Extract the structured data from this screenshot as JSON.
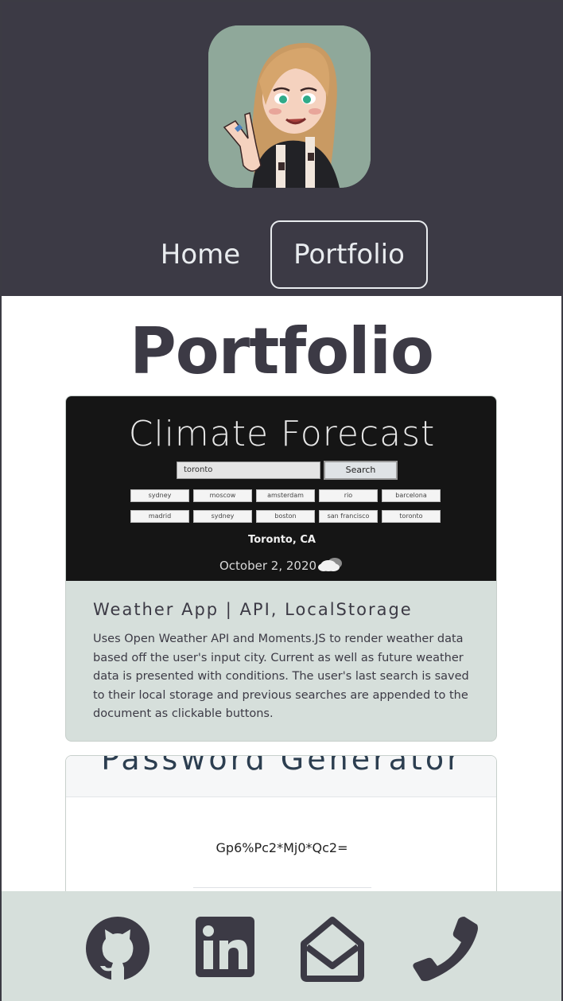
{
  "header": {
    "avatar_alt": "avatar",
    "nav": [
      {
        "label": "Home"
      },
      {
        "label": "Portfolio"
      }
    ]
  },
  "main": {
    "title": "Portfolio",
    "projects": [
      {
        "screenshot": {
          "app_title": "Climate Forecast",
          "search_value": "toronto",
          "search_button": "Search",
          "cities": [
            "sydney",
            "moscow",
            "amsterdam",
            "rio",
            "barcelona",
            "madrid",
            "sydney",
            "boston",
            "san francisco",
            "toronto"
          ],
          "current_city": "Toronto, CA",
          "date": "October 2, 2020"
        },
        "title": "Weather App | API, LocalStorage",
        "description": "Uses Open Weather API and Moments.JS to render weather data based off the user's input city. Current as well as future weather data is presented with conditions. The user's last search is saved to their local storage and previous searches are appended to the document as clickable buttons."
      },
      {
        "screenshot": {
          "app_title": "Password Generator",
          "password": "Gp6%Pc2*Mj0*Qc2="
        }
      }
    ]
  },
  "footer": {
    "icons": [
      "github-icon",
      "linkedin-icon",
      "email-icon",
      "phone-icon"
    ],
    "color": "#3c3a45"
  },
  "colors": {
    "header_bg": "#3c3a45",
    "card_bg": "#d6dfdb",
    "text": "#3c3a45"
  }
}
